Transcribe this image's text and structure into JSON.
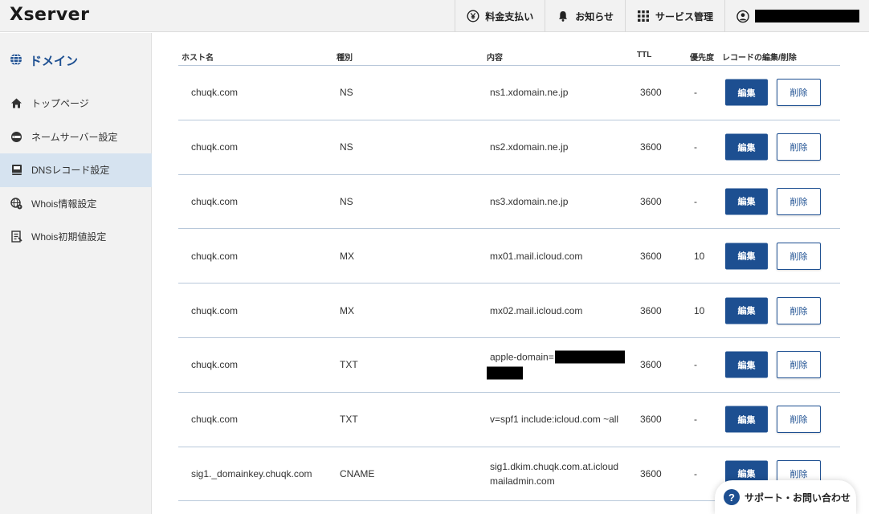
{
  "header": {
    "logo": "Xserver",
    "nav": [
      {
        "label": "料金支払い",
        "icon": "yen-circle-icon"
      },
      {
        "label": "お知らせ",
        "icon": "bell-icon"
      },
      {
        "label": "サービス管理",
        "icon": "grid-icon"
      }
    ],
    "account_icon": "user-circle-icon"
  },
  "sidebar": {
    "title": "ドメイン",
    "items": [
      {
        "label": "トップページ",
        "icon": "home-icon",
        "active": false
      },
      {
        "label": "ネームサーバー設定",
        "icon": "server-icon",
        "active": false
      },
      {
        "label": "DNSレコード設定",
        "icon": "book-icon",
        "active": true
      },
      {
        "label": "Whois情報設定",
        "icon": "globe-gear-icon",
        "active": false
      },
      {
        "label": "Whois初期値設定",
        "icon": "document-list-icon",
        "active": false
      }
    ]
  },
  "table": {
    "headers": {
      "host": "ホスト名",
      "type": "種別",
      "content": "内容",
      "ttl": "TTL",
      "priority": "優先度",
      "actions": "レコードの編集/削除"
    },
    "edit_label": "編集",
    "delete_label": "削除",
    "rows": [
      {
        "host": "chuqk.com",
        "type": "NS",
        "content": "ns1.xdomain.ne.jp",
        "content2": "",
        "ttl": "3600",
        "priority": "-"
      },
      {
        "host": "chuqk.com",
        "type": "NS",
        "content": "ns2.xdomain.ne.jp",
        "content2": "",
        "ttl": "3600",
        "priority": "-"
      },
      {
        "host": "chuqk.com",
        "type": "NS",
        "content": "ns3.xdomain.ne.jp",
        "content2": "",
        "ttl": "3600",
        "priority": "-"
      },
      {
        "host": "chuqk.com",
        "type": "MX",
        "content": "mx01.mail.icloud.com",
        "content2": "",
        "ttl": "3600",
        "priority": "10"
      },
      {
        "host": "chuqk.com",
        "type": "MX",
        "content": "mx02.mail.icloud.com",
        "content2": "",
        "ttl": "3600",
        "priority": "10"
      },
      {
        "host": "chuqk.com",
        "type": "TXT",
        "content": "apple-domain=",
        "content2": "",
        "ttl": "3600",
        "priority": "-",
        "redacted": true
      },
      {
        "host": "chuqk.com",
        "type": "TXT",
        "content": "v=spf1 include:icloud.com ~all",
        "content2": "",
        "ttl": "3600",
        "priority": "-"
      },
      {
        "host": "sig1._domainkey.chuqk.com",
        "type": "CNAME",
        "content": "sig1.dkim.chuqk.com.at.icloud",
        "content2": "mailadmin.com",
        "ttl": "3600",
        "priority": "-"
      }
    ]
  },
  "support": {
    "label": "サポート・お問い合わせ",
    "icon": "question-circle-icon"
  },
  "colors": {
    "accent": "#1d4f91",
    "sidebar_bg": "#f2f2f2",
    "active_bg": "#d6e3f0"
  }
}
